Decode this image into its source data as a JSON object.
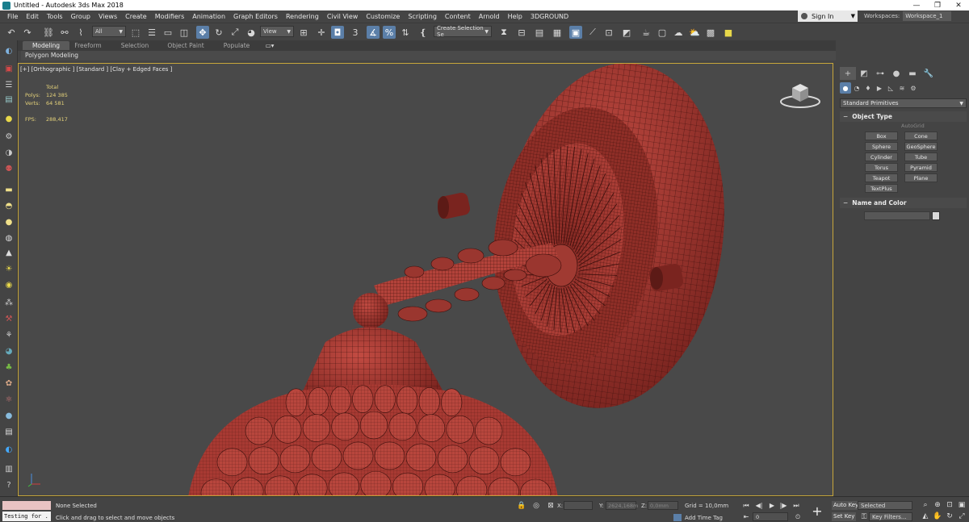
{
  "window": {
    "title": "Untitled - Autodesk 3ds Max 2018",
    "minimize": "—",
    "maximize": "❐",
    "close": "✕"
  },
  "menu": {
    "items": [
      "File",
      "Edit",
      "Tools",
      "Group",
      "Views",
      "Create",
      "Modifiers",
      "Animation",
      "Graph Editors",
      "Rendering",
      "Civil View",
      "Customize",
      "Scripting",
      "Content",
      "Arnold",
      "Help",
      "3DGROUND"
    ],
    "sign_in": "Sign In",
    "workspaces_label": "Workspaces:",
    "workspace_value": "Workspace_1"
  },
  "toolbar": {
    "selection_filter": "All",
    "reference_coord": "View",
    "named_selection": "Create Selection Se",
    "angle_snap_label": "3"
  },
  "ribbon": {
    "tabs": [
      "Modeling",
      "Freeform",
      "Selection",
      "Object Paint",
      "Populate"
    ],
    "active_tab": "Modeling",
    "sub_label": "Polygon Modeling"
  },
  "viewport": {
    "label": "[+] [Orthographic ] [Standard ] [Clay + Edged Faces ]",
    "stats": {
      "total_label": "Total",
      "polys_label": "Polys:",
      "polys_value": "124 385",
      "verts_label": "Verts:",
      "verts_value": "64 581",
      "fps_label": "FPS:",
      "fps_value": "288,417"
    },
    "model_color": "#a83a33",
    "border_color": "#c7a73b"
  },
  "command_panel": {
    "category": "Standard Primitives",
    "object_type_title": "Object Type",
    "autogrid": "AutoGrid",
    "buttons": [
      "Box",
      "Cone",
      "Sphere",
      "GeoSphere",
      "Cylinder",
      "Tube",
      "Torus",
      "Pyramid",
      "Teapot",
      "Plane",
      "TextPlus"
    ],
    "name_color_title": "Name and Color",
    "rollout_toggle": "−"
  },
  "status": {
    "maxscript_text": "Testing for .",
    "selection": "None Selected",
    "prompt": "Click and drag to select and move objects",
    "x_label": "X:",
    "x_value": "",
    "y_label": "Y:",
    "y_value": "2624,168m",
    "z_label": "Z:",
    "z_value": "0,0mm",
    "grid": "Grid = 10,0mm",
    "add_time_tag": "Add Time Tag",
    "frame": "0",
    "auto_key": "Auto Key",
    "set_key": "Set Key",
    "selected_option": "Selected",
    "key_filters": "Key Filters..."
  }
}
